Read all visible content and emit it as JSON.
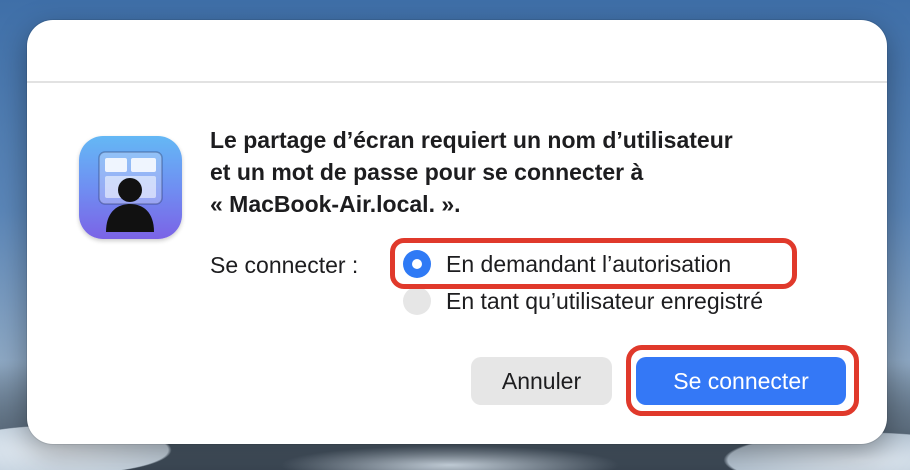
{
  "dialog": {
    "app_icon": "screen-sharing-icon",
    "message_lines": [
      "Le partage d’écran requiert un nom d’utilisateur",
      "et un mot de passe pour se connecter à",
      "« MacBook-Air.local. »."
    ],
    "connect_label": "Se connecter :",
    "options": [
      {
        "label": "En demandant l’autorisation",
        "selected": true
      },
      {
        "label": "En tant qu’utilisateur enregistré",
        "selected": false
      }
    ],
    "buttons": {
      "cancel": "Annuler",
      "connect": "Se connecter"
    }
  },
  "colors": {
    "accent": "#3478f6",
    "highlight": "#e0392b"
  }
}
